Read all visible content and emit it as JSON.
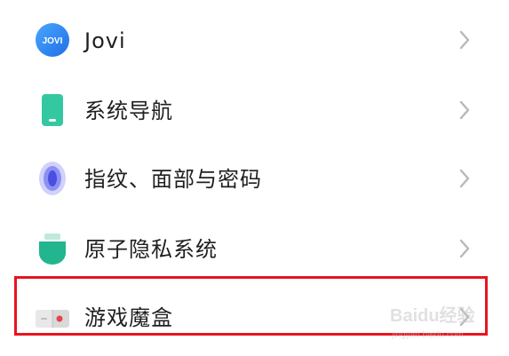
{
  "settings": {
    "items": [
      {
        "label": "Jovi",
        "icon": "jovi-icon",
        "chevron_icon": "chevron-right-icon"
      },
      {
        "label": "系统导航",
        "icon": "phone-navigation-icon",
        "chevron_icon": "chevron-right-icon"
      },
      {
        "label": "指纹、面部与密码",
        "icon": "fingerprint-icon",
        "chevron_icon": "chevron-right-icon"
      },
      {
        "label": "原子隐私系统",
        "icon": "privacy-shield-icon",
        "chevron_icon": "chevron-right-icon"
      },
      {
        "label": "游戏魔盒",
        "icon": "game-box-icon",
        "chevron_icon": "chevron-right-icon"
      }
    ]
  },
  "jovi_icon_text": "JOVI",
  "highlight_color": "#e8141f",
  "watermark": {
    "text": "Baidu经验",
    "subtext": "jingyan.baidu.com"
  },
  "colors": {
    "jovi_blue": "#1f7ef2",
    "nav_green": "#33c8a0",
    "fingerprint_purple": "#5a5fe8",
    "privacy_teal": "#22b58e",
    "chevron_gray": "#b8b8b8"
  }
}
